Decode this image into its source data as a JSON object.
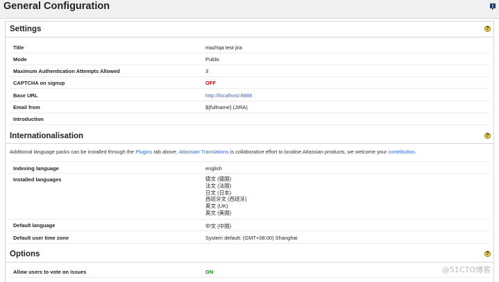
{
  "page": {
    "title": "General Configuration"
  },
  "settings": {
    "title": "Settings",
    "rows": [
      {
        "label": "Title",
        "value": "mazhqa test jira"
      },
      {
        "label": "Mode",
        "value": "Public"
      },
      {
        "label": "Maximum Authentication Attempts Allowed",
        "value": "3"
      },
      {
        "label": "CAPTCHA on signup",
        "value": "OFF"
      },
      {
        "label": "Base URL",
        "value": "http://localhost:8888"
      },
      {
        "label": "Email from",
        "value": "${fullname} (JIRA)"
      },
      {
        "label": "Introduction",
        "value": ""
      }
    ]
  },
  "internationalisation": {
    "title": "Internationalisation",
    "intro": {
      "part1": "Additional language packs can be installed through the",
      "plugins_link": "Plugins",
      "part2": "tab above.",
      "translations_link": "Atlassian Translations",
      "part3": "is collaborative effort to localise Atlassian products, we welcome your",
      "contribution_link": "contribution",
      "part4": "."
    },
    "indexing_label": "Indexing language",
    "indexing_value": "english",
    "installed_label": "Installed languages",
    "installed_languages": [
      "德文 (德国)",
      "法文 (法国)",
      "日文 (日本)",
      "西班牙文 (西班牙)",
      "英文 (UK)",
      "英文 (美国)"
    ],
    "default_language_label": "Default language",
    "default_language_value": "中文 (中国)",
    "timezone_label": "Default user time zone",
    "timezone_value": "System default: (GMT+08:00) Shanghai"
  },
  "options": {
    "title": "Options",
    "rows": [
      {
        "label": "Allow users to vote on issues",
        "value": "ON"
      }
    ]
  },
  "help_glyph": "?",
  "watermark": "@51CTO博客",
  "colors": {
    "off": "#cc0000",
    "on": "#009900",
    "link": "#3366cc",
    "help_icon": "#e4c94e"
  }
}
